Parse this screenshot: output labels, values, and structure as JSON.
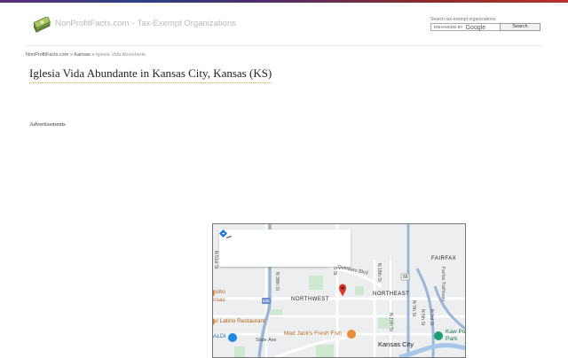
{
  "header": {
    "site_name": "NonProfitFacts.com",
    "separator": "-",
    "tagline": "Tax-Exempt Organizations",
    "logo_icon": "money-stack-icon"
  },
  "search": {
    "label": "Search tax-exempt organizations:",
    "enhanced_by": "ENHANCED BY",
    "google": "Google",
    "button_label": "Search"
  },
  "breadcrumb": {
    "home": "NonProfitFacts.com",
    "sep1": "»",
    "state": "Kansas",
    "sep2": "»",
    "current": "Iglesia Vida Abundante"
  },
  "page": {
    "title": "Iglesia Vida Abundante in Kansas City, Kansas (KS)",
    "ads_label": "Advertisements"
  },
  "map": {
    "pin_color": "#d93a2c",
    "card_icon": "directions-icon",
    "labels": {
      "n51": "N 51st St",
      "n38": "N 38th St",
      "quindaro": "Quindaro Blvd",
      "fairfax": "FAIRFAX",
      "fairfax_tfwy": "Fairfax Trafficway",
      "northeast": "NORTHEAST",
      "northwest": "NORTHWEST",
      "route69": "69",
      "i635": "635",
      "nancito": "ncito",
      "nasas": "nsas",
      "latino": "or Latino Restaurant",
      "madjacks": "Mad Jack's Fresh Fish",
      "aldi": "ALDI",
      "state_ave": "State Ave",
      "kansas_city": "Kansas City",
      "kaw": "Kaw Po",
      "park": "Park",
      "n7th": "N 7th St",
      "n5th": "N 5th St",
      "n3rd": "N 3rd St",
      "n18th": "N 18th St",
      "n10th": "N 10th St",
      "s_st": "S St"
    }
  }
}
